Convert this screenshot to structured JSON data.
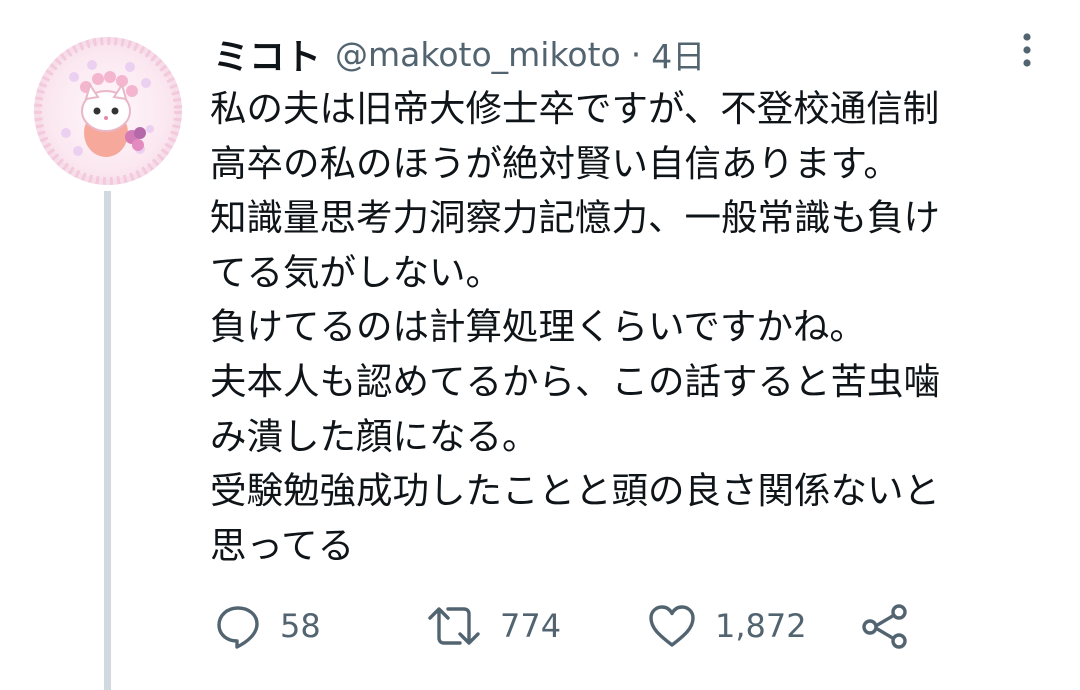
{
  "tweet": {
    "display_name": "ミコト",
    "handle": "@makoto_mikoto",
    "separator": "·",
    "time": "4日",
    "lines": [
      "私の夫は旧帝大修士卒ですが、不登校通信制",
      "高卒の私のほうが絶対賢い自信あります。",
      "知識量思考力洞察力記憶力、一般常識も負け",
      "てる気がしない。",
      "負けてるのは計算処理くらいですかね。",
      "夫本人も認めてるから、この話すると苦虫噛",
      "み潰した顔になる。",
      "受験勉強成功したことと頭の良さ関係ないと",
      "思ってる"
    ]
  },
  "actions": {
    "reply": {
      "icon": "reply-icon",
      "count": "58"
    },
    "retweet": {
      "icon": "retweet-icon",
      "count": "774"
    },
    "like": {
      "icon": "heart-icon",
      "count": "1,872"
    },
    "share": {
      "icon": "share-icon"
    },
    "more": {
      "icon": "more-vertical-icon"
    }
  },
  "colors": {
    "text": "#0f1419",
    "secondary": "#536471",
    "thread_line": "#cfd9de",
    "avatar_accent": "#f4b6cf"
  }
}
